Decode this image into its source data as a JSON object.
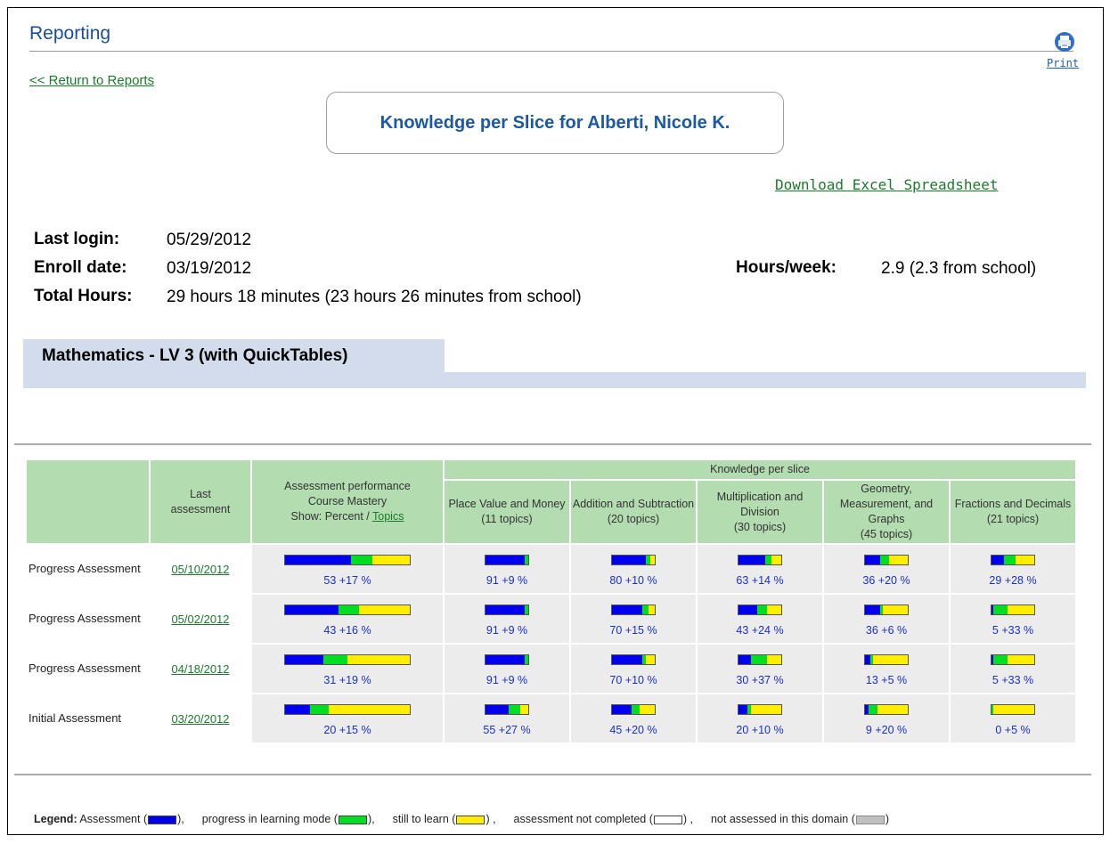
{
  "header": {
    "title": "Reporting",
    "print_label": "Print",
    "return_link": "<< Return to Reports",
    "report_title": "Knowledge per Slice for Alberti, Nicole K.",
    "excel_link": "Download Excel Spreadsheet"
  },
  "info": {
    "last_login_label": "Last login:",
    "last_login": "05/29/2012",
    "enroll_label": "Enroll date:",
    "enroll": "03/19/2012",
    "hours_week_label": "Hours/week:",
    "hours_week": "2.9 (2.3 from school)",
    "total_label": "Total Hours:",
    "total": "29 hours 18 minutes (23 hours 26 minutes from school)"
  },
  "course": {
    "title": "Mathematics - LV 3 (with QuickTables)"
  },
  "table": {
    "knowledge_header": "Knowledge per slice",
    "col_last": "Last assessment",
    "col_perf_lines": [
      "Assessment performance",
      "Course Mastery",
      "Show: Percent / "
    ],
    "col_perf_topics": "Topics",
    "slices": [
      {
        "name": "Place Value and Money",
        "topics": "(11 topics)"
      },
      {
        "name": "Addition and Subtraction",
        "topics": "(20 topics)"
      },
      {
        "name": "Multiplication and Division",
        "topics": "(30 topics)"
      },
      {
        "name": "Geometry, Measurement, and Graphs",
        "topics": "(45 topics)"
      },
      {
        "name": "Fractions and Decimals",
        "topics": "(21 topics)"
      }
    ],
    "rows": [
      {
        "label": "Progress Assessment",
        "date": "05/10/2012",
        "overall": {
          "a": 53,
          "p": 17,
          "text": "53 +17 %"
        },
        "slices": [
          {
            "a": 91,
            "p": 9,
            "text": "91 +9 %"
          },
          {
            "a": 80,
            "p": 10,
            "text": "80 +10 %"
          },
          {
            "a": 63,
            "p": 14,
            "text": "63 +14 %"
          },
          {
            "a": 36,
            "p": 20,
            "text": "36 +20 %"
          },
          {
            "a": 29,
            "p": 28,
            "text": "29 +28 %"
          }
        ]
      },
      {
        "label": "Progress Assessment",
        "date": "05/02/2012",
        "overall": {
          "a": 43,
          "p": 16,
          "text": "43 +16 %"
        },
        "slices": [
          {
            "a": 91,
            "p": 9,
            "text": "91 +9 %"
          },
          {
            "a": 70,
            "p": 15,
            "text": "70 +15 %"
          },
          {
            "a": 43,
            "p": 24,
            "text": "43 +24 %"
          },
          {
            "a": 36,
            "p": 6,
            "text": "36 +6 %"
          },
          {
            "a": 5,
            "p": 33,
            "text": "5 +33 %"
          }
        ]
      },
      {
        "label": "Progress Assessment",
        "date": "04/18/2012",
        "overall": {
          "a": 31,
          "p": 19,
          "text": "31 +19 %"
        },
        "slices": [
          {
            "a": 91,
            "p": 9,
            "text": "91 +9 %"
          },
          {
            "a": 70,
            "p": 10,
            "text": "70 +10 %"
          },
          {
            "a": 30,
            "p": 37,
            "text": "30 +37 %"
          },
          {
            "a": 13,
            "p": 5,
            "text": "13 +5 %"
          },
          {
            "a": 5,
            "p": 33,
            "text": "5 +33 %"
          }
        ]
      },
      {
        "label": "Initial Assessment",
        "date": "03/20/2012",
        "overall": {
          "a": 20,
          "p": 15,
          "text": "20 +15 %"
        },
        "slices": [
          {
            "a": 55,
            "p": 27,
            "text": "55 +27 %"
          },
          {
            "a": 45,
            "p": 20,
            "text": "45 +20 %"
          },
          {
            "a": 20,
            "p": 10,
            "text": "20 +10 %"
          },
          {
            "a": 9,
            "p": 20,
            "text": "9 +20 %"
          },
          {
            "a": 0,
            "p": 5,
            "text": "0 +5 %"
          }
        ]
      }
    ]
  },
  "legend": {
    "label": "Legend:",
    "assessment": "Assessment (",
    "progress": "progress in learning mode (",
    "still": "still to learn (",
    "not_completed": "assessment not completed (",
    "not_assessed": "not assessed in this domain (",
    "close_comma": "),",
    "close_comma_spaced": ") ,",
    "close": ")"
  },
  "colors": {
    "assessment": "#0000ee",
    "progress": "#00dd22",
    "still_to_learn": "#ffee00",
    "header_green": "#b3dcb0",
    "course_tab": "#d3dcec",
    "link_green": "#1a7b2c",
    "title_blue": "#1a4e9a"
  }
}
